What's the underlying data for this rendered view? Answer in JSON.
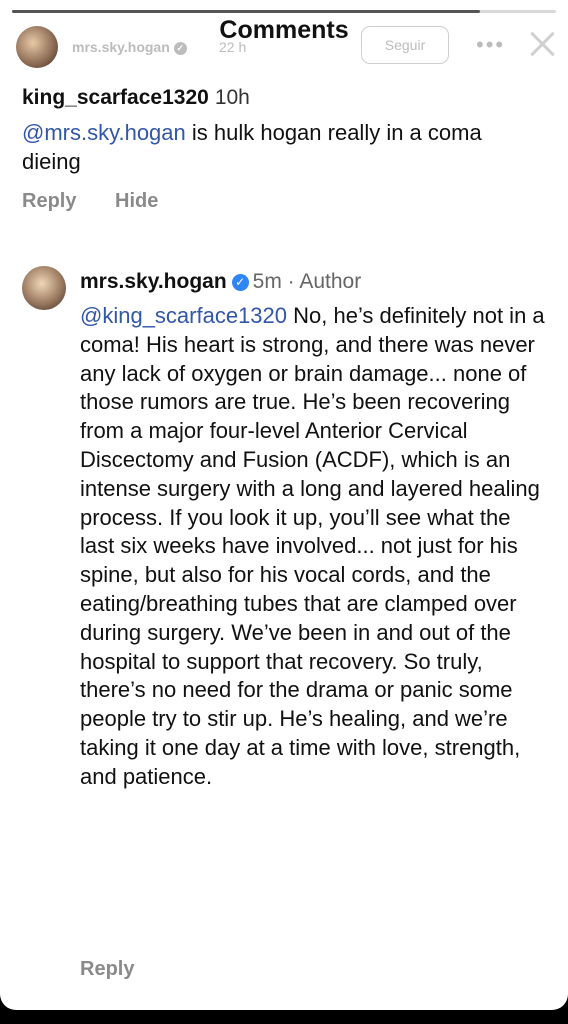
{
  "header": {
    "title": "Comments",
    "story_user": "mrs.sky.hogan",
    "story_time": "22 h",
    "follow_label": "Seguir",
    "more_icon": "more-horizontal-icon",
    "close_icon": "close-icon"
  },
  "comments": [
    {
      "username": "king_scarface1320",
      "time": "10h",
      "mention": "@mrs.sky.hogan",
      "text": " is hulk hogan really in a coma dieing",
      "reply_label": "Reply",
      "hide_label": "Hide"
    },
    {
      "username": "mrs.sky.hogan",
      "verified_icon": "verified-badge-icon",
      "meta": "5m · Author",
      "mention": "@king_scarface1320",
      "text": " No, he’s definitely not in a coma! His heart is strong, and there was never any lack of oxygen or brain damage... none of those rumors are true. He’s been recovering from a major four-level Anterior Cervical Discectomy and Fusion (ACDF), which is an intense surgery with a long and layered healing process. If you look it up, you’ll see what the last six weeks have involved... not just for his spine, but also for his vocal cords, and the eating/breathing tubes that are clamped over during surgery. We’ve been in and out of the hospital to support that recovery. So truly, there’s no need for the drama or panic some people try to stir up. He’s healing, and we’re taking it one day at a time with love, strength, and patience.",
      "reply_label": "Reply"
    }
  ],
  "colors": {
    "mention": "#3256a8",
    "verified": "#2f86f6",
    "action": "#8a8a8a"
  }
}
